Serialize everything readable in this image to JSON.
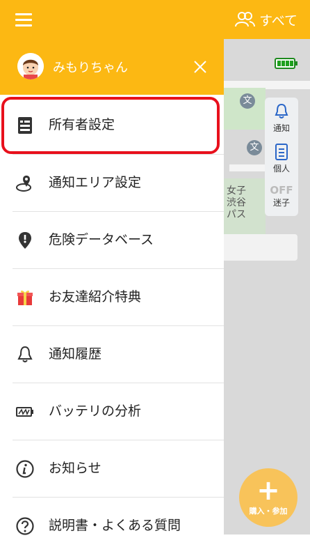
{
  "topbar": {
    "menu_icon": "hamburger-icon",
    "filter_label": "すべて",
    "filter_icon": "people-icon",
    "bg_color": "#fcb813"
  },
  "drawer": {
    "username": "みもりちゃん",
    "avatar_icon": "child-avatar",
    "close_icon": "close-icon",
    "highlight_color": "#e8101c",
    "items": [
      {
        "label": "所有者設定",
        "icon": "owner-settings-icon"
      },
      {
        "label": "通知エリア設定",
        "icon": "notification-area-icon"
      },
      {
        "label": "危険データベース",
        "icon": "danger-pin-icon"
      },
      {
        "label": "お友達紹介特典",
        "icon": "gift-icon"
      },
      {
        "label": "通知履歴",
        "icon": "bell-icon"
      },
      {
        "label": "バッテリの分析",
        "icon": "battery-icon"
      },
      {
        "label": "お知らせ",
        "icon": "info-icon"
      },
      {
        "label": "説明書・よくある質問",
        "icon": "question-icon"
      }
    ]
  },
  "map": {
    "side_tools": [
      {
        "label": "通知",
        "icon": "bell-icon"
      },
      {
        "label": "個人",
        "icon": "person-card-icon"
      },
      {
        "label": "迷子",
        "icon": "off-toggle-icon",
        "badge": "OFF"
      }
    ],
    "map_labels": [
      "女子",
      "渋谷",
      "パス"
    ],
    "fab_label": "購入・参加",
    "fab_icon": "plus-icon"
  }
}
